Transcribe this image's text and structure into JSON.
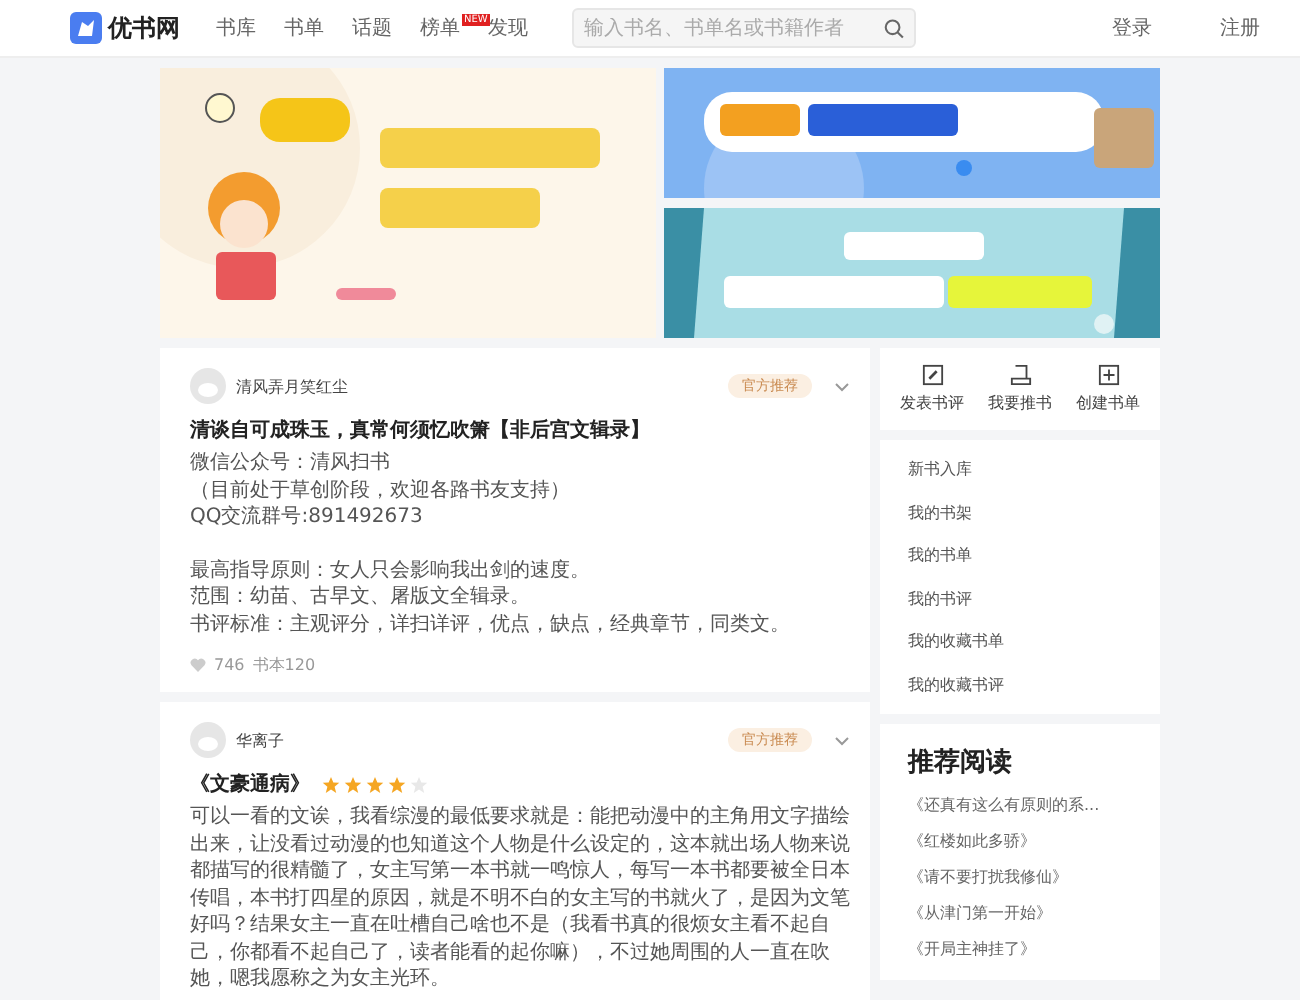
{
  "header": {
    "logo": "优书网",
    "nav": [
      {
        "label": "书库",
        "selected": false
      },
      {
        "label": "书单",
        "selected": false
      },
      {
        "label": "话题",
        "selected": false
      },
      {
        "label": "榜单",
        "selected": false,
        "badge": "NEW"
      },
      {
        "label": "发现",
        "selected": false
      }
    ],
    "search": {
      "placeholder": "输入书名、书单名或书籍作者"
    },
    "login": "登录",
    "register": "注册"
  },
  "banners": [
    {
      "kind": "picture"
    },
    {
      "kind": "picture"
    },
    {
      "kind": "picture"
    }
  ],
  "posts": [
    {
      "author": "清风弄月笑红尘",
      "tag": "官方推荐",
      "title": "清谈自可成珠玉，真常何须忆吹箫【非后宫文辑录】",
      "lines": [
        {
          "kind": "text",
          "text": " 微信公众号：清风扫书"
        },
        {
          "kind": "text",
          "text": " （目前处于草创阶段，欢迎各路书友支持）"
        },
        {
          "kind": "text",
          "text": "QQ交流群号:891492673"
        },
        {
          "kind": "blank"
        },
        {
          "kind": "text",
          "text": "最高指导原则：女人只会影响我出剑的速度。"
        },
        {
          "kind": "text",
          "text": "范围：幼苗、古早文、屠版文全辑录。"
        },
        {
          "kind": "text",
          "text": "书评标准：主观评分，详扫详评，优点，缺点，经典章节，同类文。"
        }
      ],
      "likes": "746",
      "books": "书本120"
    },
    {
      "author": "华离子",
      "tag": "官方推荐",
      "title": "《文豪通病》",
      "stars": 4,
      "lines": [
        {
          "kind": "text",
          "text": " 可以一看的文诶，我看综漫的最低要求就是：能把动漫中的主角用文字描绘出来，让没看过动漫的也知道这个人物是什么设定的，这本就出场人物来说都描写的很精髓了，女主写第一本书就一鸣惊人，每写一本书都要被全日本传唱，本书打四星的原因，就是不明不白的女主写的书就火了，是因为文笔好吗？结果女主一直在吐槽自己啥也不是（我看书真的很烦女主看不起自己，你都看不起自己了，读者能看的起你嘛），不过她周围的人一直在吹她，嗯我愿称之为女主光环。"
        }
      ]
    }
  ],
  "actions": [
    {
      "kind": "edit",
      "label": "发表书评"
    },
    {
      "kind": "clipboard",
      "label": "我要推书"
    },
    {
      "kind": "plus",
      "label": "创建书单"
    }
  ],
  "menu": [
    "新书入库",
    "我的书架",
    "我的书单",
    "我的书评",
    "我的收藏书单",
    "我的收藏书评"
  ],
  "recommend": {
    "title": "推荐阅读",
    "items": [
      "《还真有这么有原则的系...",
      "《红楼如此多骄》",
      "《请不要打扰我修仙》",
      "《从津门第一开始》",
      "《开局主神挂了》"
    ]
  }
}
